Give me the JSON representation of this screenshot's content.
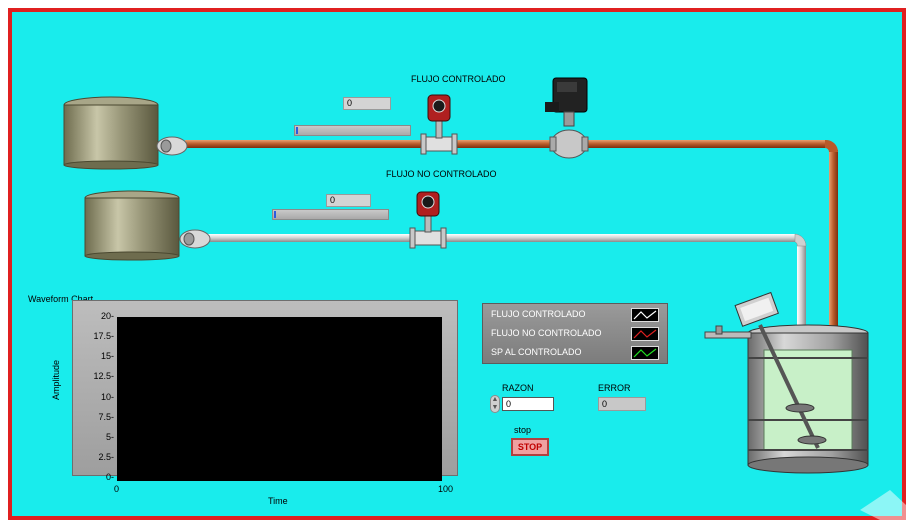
{
  "panel": {
    "flow_controlled_label": "FLUJO CONTROLADO",
    "flow_uncontrolled_label": "FLUJO NO CONTROLADO"
  },
  "indicators": {
    "controlled_value": "0",
    "uncontrolled_value": "0",
    "controlled_slider_level": 0,
    "uncontrolled_slider_level": 0
  },
  "chart": {
    "title": "Waveform Chart",
    "xlabel": "Time",
    "ylabel": "Amplitude",
    "y_ticks": [
      "20",
      "17.5",
      "15",
      "12.5",
      "10",
      "7.5",
      "5",
      "2.5",
      "0"
    ],
    "x_ticks": [
      "0",
      "100"
    ]
  },
  "chart_data": {
    "type": "line",
    "title": "Waveform Chart",
    "xlabel": "Time",
    "ylabel": "Amplitude",
    "xlim": [
      0,
      100
    ],
    "ylim": [
      0,
      20
    ],
    "series": []
  },
  "legend": {
    "items": [
      {
        "label": "FLUJO CONTROLADO"
      },
      {
        "label": "FLUJO NO CONTROLADO"
      },
      {
        "label": "SP AL CONTROLADO"
      }
    ]
  },
  "controls": {
    "razon_label": "RAZON",
    "razon_value": "0",
    "error_label": "ERROR",
    "error_value": "0",
    "stop_caption": "stop",
    "stop_button": "STOP"
  },
  "colors": {
    "panel_bg": "#19ecec",
    "panel_border": "#e02020",
    "controlled_pipe": "#b85a2a",
    "uncontrolled_pipe": "#d8d8d8",
    "tank": "#8c8a66",
    "mixer_liquid": "#c8f0c8"
  },
  "icons": {
    "tank_1": "storage-tank-icon",
    "tank_2": "storage-tank-icon",
    "flowmeter": "flowmeter-icon",
    "valve": "control-valve-icon",
    "mixer": "mixing-tank-icon"
  }
}
